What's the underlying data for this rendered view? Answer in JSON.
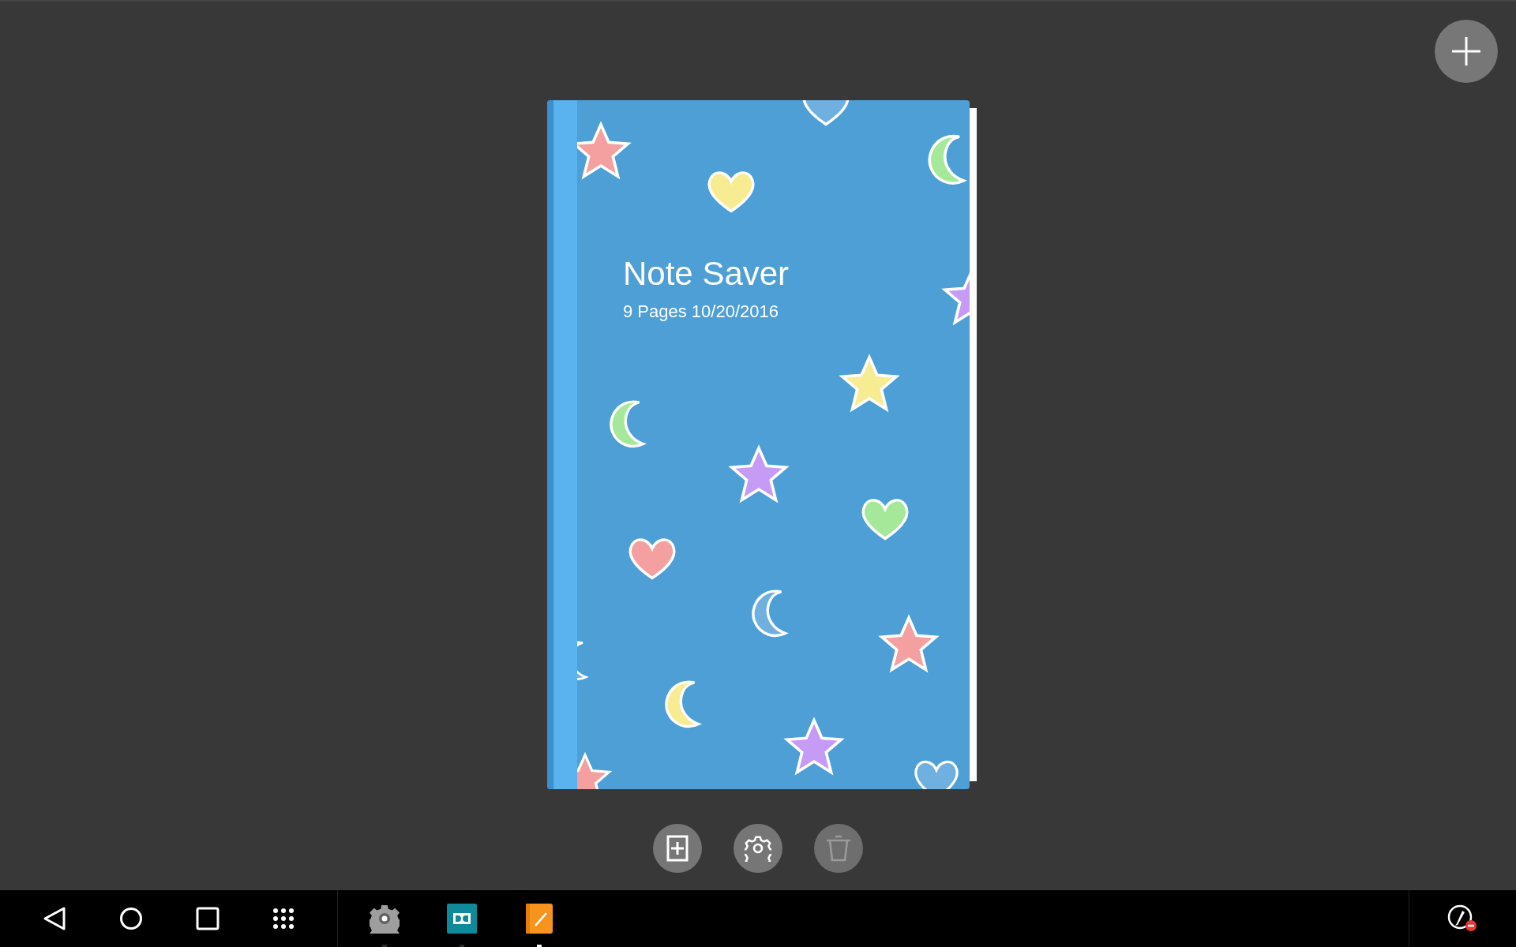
{
  "notebook": {
    "title": "Note Saver",
    "subtitle": "9 Pages 10/20/2016"
  },
  "actions": [
    {
      "kind": "add-page",
      "disabled": false
    },
    {
      "kind": "settings",
      "disabled": false
    },
    {
      "kind": "delete",
      "disabled": true
    }
  ],
  "taskbar_apps": [
    {
      "kind": "settings",
      "selected": false
    },
    {
      "kind": "dolby",
      "selected": false
    },
    {
      "kind": "notes",
      "selected": true
    }
  ]
}
